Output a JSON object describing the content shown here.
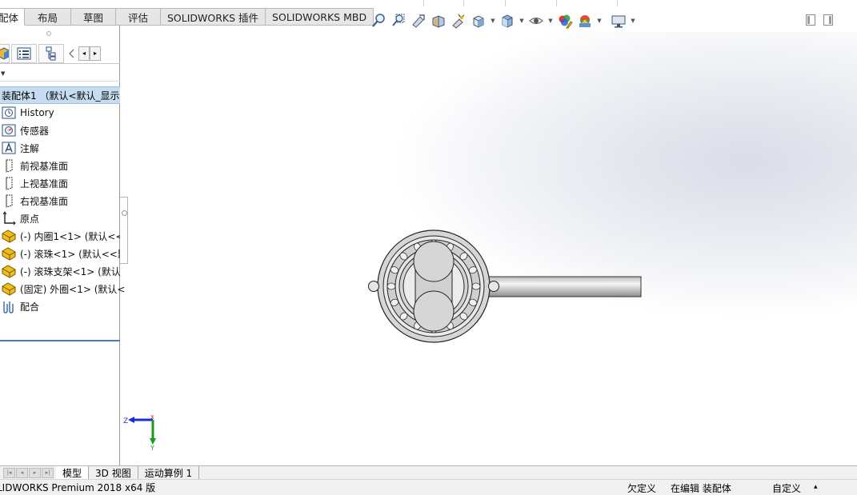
{
  "command_tabs": [
    {
      "label": "配体",
      "active": true
    },
    {
      "label": "布局",
      "active": false
    },
    {
      "label": "草图",
      "active": false
    },
    {
      "label": "评估",
      "active": false
    },
    {
      "label": "SOLIDWORKS 插件",
      "active": false
    },
    {
      "label": "SOLIDWORKS MBD",
      "active": false
    }
  ],
  "view_toolbar": {
    "icons": [
      "zoom-to-fit-icon",
      "zoom-to-area-icon",
      "previous-view-icon",
      "section-view-icon",
      "dynamic-annotation-icon",
      "view-orientation-icon",
      "display-style-icon",
      "hide-show-items-icon",
      "edit-appearance-icon",
      "apply-scene-icon",
      "view-settings-icon"
    ]
  },
  "feature_manager": {
    "panel_tabs": [
      "feature-manager-tab",
      "property-manager-tab",
      "configuration-manager-tab"
    ],
    "root_item": "装配体1 （默认<默认_显示状",
    "items": [
      {
        "icon": "history-icon",
        "label": "History"
      },
      {
        "icon": "sensors-icon",
        "label": "传感器"
      },
      {
        "icon": "annotations-icon",
        "label": "注解"
      },
      {
        "icon": "plane-icon",
        "label": "前视基准面"
      },
      {
        "icon": "plane-icon",
        "label": "上视基准面"
      },
      {
        "icon": "plane-icon",
        "label": "右视基准面"
      },
      {
        "icon": "origin-icon",
        "label": "原点"
      },
      {
        "icon": "part-icon",
        "label": "(-) 内圈1<1> (默认<<"
      },
      {
        "icon": "part-icon",
        "label": "(-) 滚珠<1> (默认<<默"
      },
      {
        "icon": "part-icon",
        "label": "(-) 滚珠支架<1> (默认"
      },
      {
        "icon": "part-icon",
        "label": "(固定) 外圈<1> (默认<"
      },
      {
        "icon": "mates-icon",
        "label": "配合"
      }
    ]
  },
  "triad": {
    "z_label": "Z",
    "y_label": "Y",
    "x_label": "X"
  },
  "bottom_tabs": [
    {
      "label": "模型",
      "active": true
    },
    {
      "label": "3D 视图",
      "active": false
    },
    {
      "label": "运动算例 1",
      "active": false
    }
  ],
  "status_bar": {
    "app": "LIDWORKS Premium 2018 x64 版",
    "underdefined": "欠定义",
    "editing": "在编辑 装配体",
    "custom": "自定义",
    "caret": "▴"
  },
  "colors": {
    "selection": "#c5dcf1",
    "part_icon": "#e8b400",
    "triad_z": "#1b2fd0",
    "triad_y": "#1a9a1a",
    "model_gray": "#d9d9d9"
  }
}
